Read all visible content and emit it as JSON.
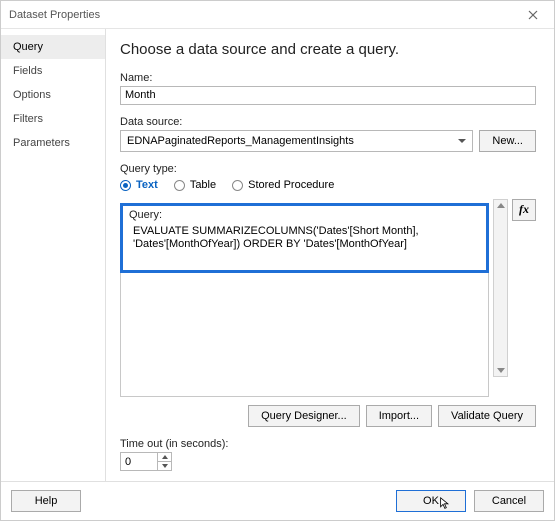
{
  "title": "Dataset Properties",
  "sidebar": {
    "items": [
      {
        "label": "Query"
      },
      {
        "label": "Fields"
      },
      {
        "label": "Options"
      },
      {
        "label": "Filters"
      },
      {
        "label": "Parameters"
      }
    ]
  },
  "main": {
    "heading": "Choose a data source and create a query.",
    "name_label": "Name:",
    "name_value": "Month",
    "datasource_label": "Data source:",
    "datasource_value": "EDNAPaginatedReports_ManagementInsights",
    "new_button": "New...",
    "query_type_label": "Query type:",
    "query_type": {
      "text": "Text",
      "table": "Table",
      "stored_proc": "Stored Procedure"
    },
    "query_label": "Query:",
    "query_text": "EVALUATE SUMMARIZECOLUMNS('Dates'[Short Month], 'Dates'[MonthOfYear]) ORDER BY 'Dates'[MonthOfYear]",
    "fx": "fx",
    "buttons": {
      "designer": "Query Designer...",
      "import": "Import...",
      "validate": "Validate Query"
    },
    "timeout_label": "Time out (in seconds):",
    "timeout_value": "0"
  },
  "footer": {
    "help": "Help",
    "ok": "OK",
    "cancel": "Cancel"
  }
}
